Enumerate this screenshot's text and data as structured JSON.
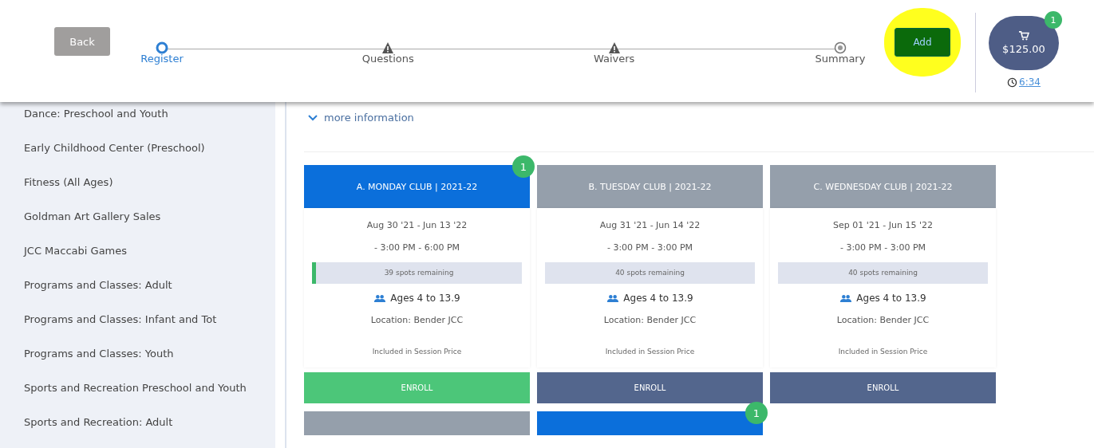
{
  "header": {
    "back_button": "Back",
    "steps": [
      {
        "label": "Register",
        "kind": "current",
        "selected": true
      },
      {
        "label": "Questions",
        "kind": "warning",
        "selected": false
      },
      {
        "label": "Waivers",
        "kind": "warning",
        "selected": false
      },
      {
        "label": "Summary",
        "kind": "pending",
        "selected": false
      }
    ],
    "add_button": "Add",
    "cart": {
      "total": "$125.00",
      "badge": "1",
      "timer": "6:34"
    }
  },
  "sidebar": {
    "items": [
      "Dance: Preschool and Youth",
      "Early Childhood Center (Preschool)",
      "Fitness (All Ages)",
      "Goldman Art Gallery Sales",
      "JCC Maccabi Games",
      "Programs and Classes: Adult",
      "Programs and Classes: Infant and Tot",
      "Programs and Classes: Youth",
      "Sports and Recreation Preschool and Youth",
      "Sports and Recreation: Adult"
    ]
  },
  "more_information": "more information",
  "sessions": [
    {
      "title": "A. MONDAY CLUB | 2021-22",
      "selected": true,
      "badge": "1",
      "in_cart": true,
      "dates": "Aug 30 '21 - Jun 13 '22",
      "time": "- 3:00 PM - 6:00 PM",
      "spots": "39 spots remaining",
      "ages": "Ages 4 to 13.9",
      "location": "Location: Bender JCC",
      "price": "Included in Session Price",
      "enroll": "ENROLL"
    },
    {
      "title": "B. TUESDAY CLUB | 2021-22",
      "selected": false,
      "in_cart": false,
      "dates": "Aug 31 '21 - Jun 14 '22",
      "time": "- 3:00 PM - 3:00 PM",
      "spots": "40 spots remaining",
      "ages": "Ages 4 to 13.9",
      "location": "Location: Bender JCC",
      "price": "Included in Session Price",
      "enroll": "ENROLL"
    },
    {
      "title": "C. WEDNESDAY CLUB | 2021-22",
      "selected": false,
      "in_cart": false,
      "dates": "Sep 01 '21 - Jun 15 '22",
      "time": "- 3:00 PM - 3:00 PM",
      "spots": "40 spots remaining",
      "ages": "Ages 4 to 13.9",
      "location": "Location: Bender JCC",
      "price": "Included in Session Price",
      "enroll": "ENROLL"
    },
    {
      "selected": false
    },
    {
      "selected": true,
      "badge": "1"
    }
  ]
}
